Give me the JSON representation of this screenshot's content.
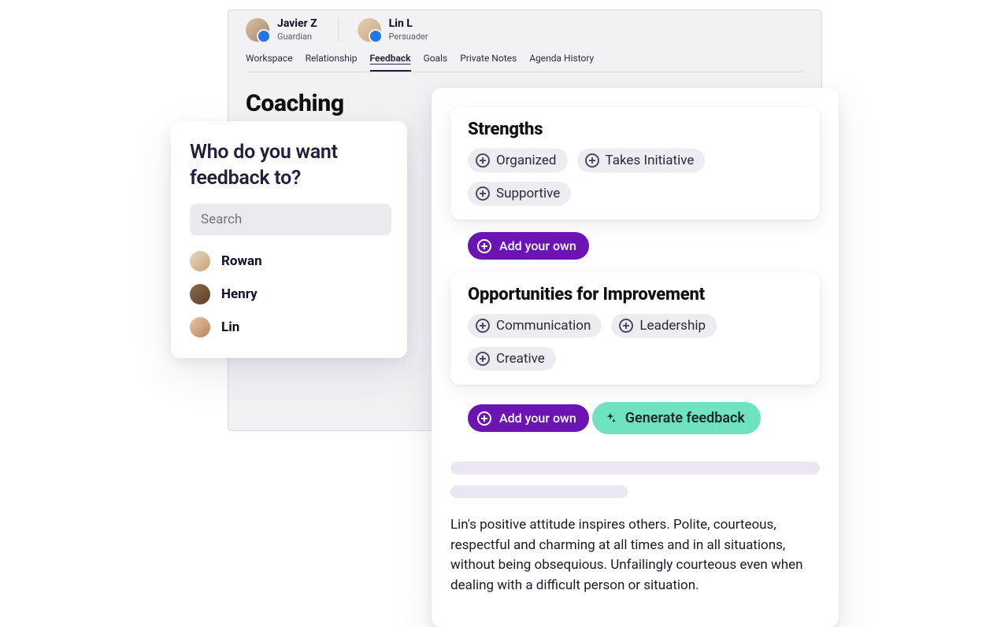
{
  "header": {
    "people": [
      {
        "name": "Javier Z",
        "role": "Guardian"
      },
      {
        "name": "Lin L",
        "role": "Persuader"
      }
    ],
    "tabs": [
      "Workspace",
      "Relationship",
      "Feedback",
      "Goals",
      "Private Notes",
      "Agenda History"
    ],
    "active_tab_index": 2,
    "page_title": "Coaching"
  },
  "search_card": {
    "title": "Who do you want feedback to?",
    "placeholder": "Search",
    "people": [
      "Rowan",
      "Henry",
      "Lin"
    ]
  },
  "feedback": {
    "strengths": {
      "title": "Strengths",
      "chips": [
        "Organized",
        "Takes Initiative",
        "Supportive"
      ]
    },
    "opportunities": {
      "title": "Opportunities for Improvement",
      "chips": [
        "Communication",
        "Leadership",
        "Creative"
      ]
    },
    "add_own_label": "Add your own",
    "generate_label": "Generate feedback",
    "generated_text": "Lin's positive attitude inspires others. Polite, courteous, respectful and charming at all times and in all situations, without being obsequious. Unfailingly courteous even when dealing with a difficult person or situation."
  },
  "icons": {
    "search": "search-icon",
    "plus": "plus-circle-icon",
    "sparkle": "sparkle-icon"
  },
  "colors": {
    "purple": "#6b13b3",
    "teal": "#6fe3c0"
  }
}
